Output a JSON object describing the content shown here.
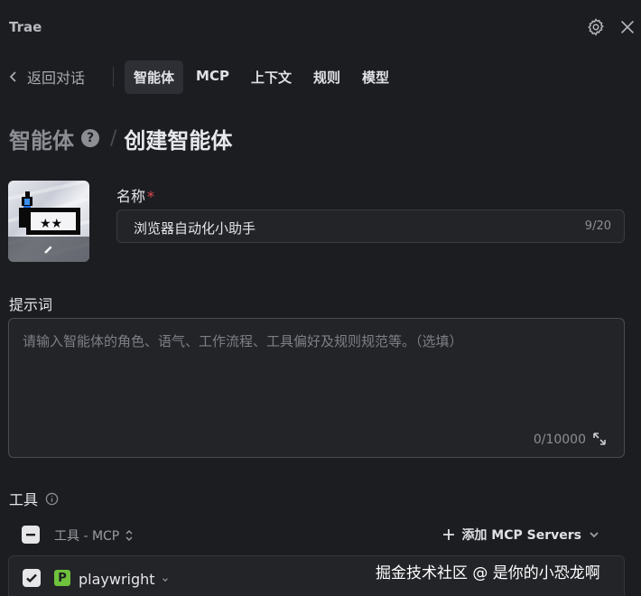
{
  "app": {
    "title": "Trae"
  },
  "titlebar": {
    "icons": [
      "gear-icon",
      "close-icon"
    ]
  },
  "nav": {
    "back_label": "返回对话",
    "tabs": [
      {
        "label": "智能体",
        "active": true
      },
      {
        "label": "MCP",
        "active": false
      },
      {
        "label": "上下文",
        "active": false
      },
      {
        "label": "规则",
        "active": false
      },
      {
        "label": "模型",
        "active": false
      }
    ]
  },
  "header": {
    "parent": "智能体",
    "separator": "/",
    "current": "创建智能体",
    "help_glyph": "?"
  },
  "form": {
    "name_label": "名称",
    "required_mark": "*",
    "name_value": "浏览器自动化小助手",
    "name_count": "9/20",
    "prompt_label": "提示词",
    "prompt_placeholder": "请输入智能体的角色、语气、工作流程、工具偏好及规则规范等。（选填）",
    "prompt_count": "0/10000"
  },
  "tools": {
    "label": "工具",
    "filter_label": "工具 - MCP",
    "add_label": "添加 MCP Servers",
    "items": [
      {
        "badge": "P",
        "name": "playwright",
        "checked": true
      }
    ]
  },
  "watermark": "掘金技术社区 @ 是你的小恐龙啊",
  "colors": {
    "background": "#1c1d21",
    "input_bg": "#232428",
    "accent_badge": "#6fc23c",
    "required": "#e5484d"
  }
}
